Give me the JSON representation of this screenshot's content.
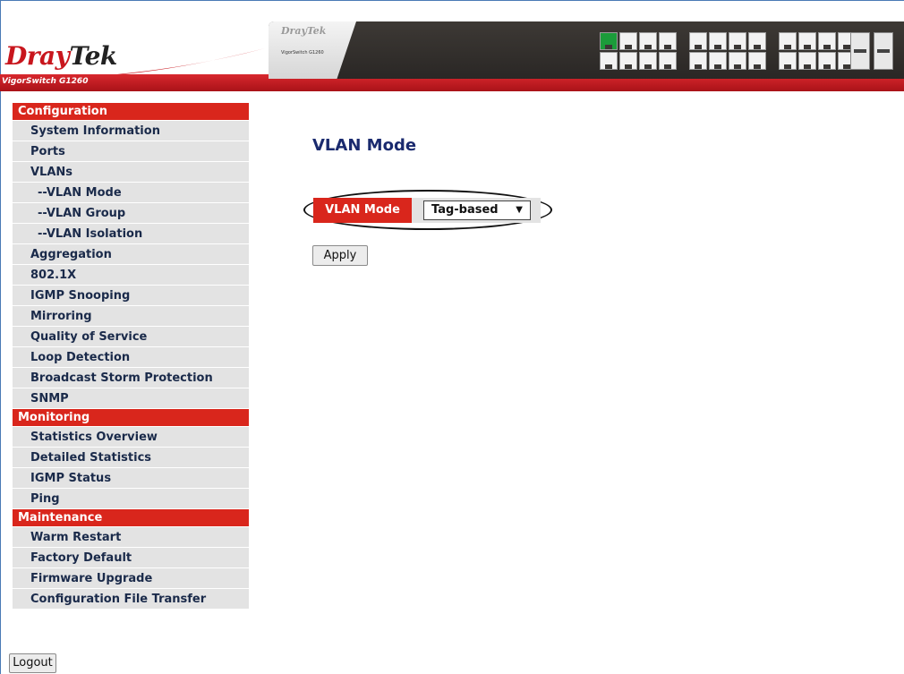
{
  "header": {
    "brand_part1": "Dray",
    "brand_part2": "Tek",
    "model": "VigorSwitch G1260",
    "device_logo": "DrayTek",
    "device_model": "VigorSwitch G1260"
  },
  "sidebar": {
    "sections": [
      {
        "title": "Configuration",
        "items": [
          {
            "label": "System Information",
            "sub": false
          },
          {
            "label": "Ports",
            "sub": false
          },
          {
            "label": "VLANs",
            "sub": false
          },
          {
            "label": "--VLAN Mode",
            "sub": true
          },
          {
            "label": "--VLAN Group",
            "sub": true
          },
          {
            "label": "--VLAN Isolation",
            "sub": true
          },
          {
            "label": "Aggregation",
            "sub": false
          },
          {
            "label": "802.1X",
            "sub": false
          },
          {
            "label": "IGMP Snooping",
            "sub": false
          },
          {
            "label": "Mirroring",
            "sub": false
          },
          {
            "label": "Quality of Service",
            "sub": false
          },
          {
            "label": "Loop Detection",
            "sub": false
          },
          {
            "label": "Broadcast Storm Protection",
            "sub": false
          },
          {
            "label": "SNMP",
            "sub": false
          }
        ]
      },
      {
        "title": "Monitoring",
        "items": [
          {
            "label": "Statistics Overview",
            "sub": false
          },
          {
            "label": "Detailed Statistics",
            "sub": false
          },
          {
            "label": "IGMP Status",
            "sub": false
          },
          {
            "label": "Ping",
            "sub": false
          }
        ]
      },
      {
        "title": "Maintenance",
        "items": [
          {
            "label": "Warm Restart",
            "sub": false
          },
          {
            "label": "Factory Default",
            "sub": false
          },
          {
            "label": "Firmware Upgrade",
            "sub": false
          },
          {
            "label": "Configuration File Transfer",
            "sub": false
          }
        ]
      }
    ],
    "logout_label": "Logout"
  },
  "main": {
    "title": "VLAN Mode",
    "field_label": "VLAN Mode",
    "select_value": "Tag-based",
    "select_arrow": "▼",
    "apply_label": "Apply"
  },
  "colors": {
    "accent_red": "#d9261c",
    "nav_bg": "#e3e3e3",
    "title_navy": "#1a2a6e"
  }
}
